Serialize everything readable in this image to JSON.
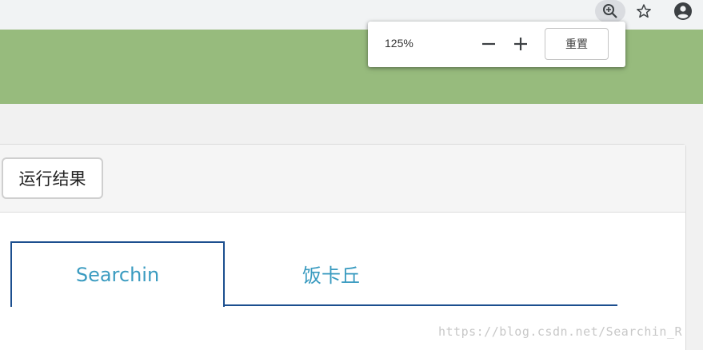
{
  "browser": {
    "icons": [
      "zoom-icon",
      "star-icon",
      "account-icon"
    ]
  },
  "zoom_popup": {
    "level": "125%",
    "reset_label": "重置"
  },
  "panel": {
    "run_button_label": "运行结果"
  },
  "tabs": [
    {
      "label": "Searchin",
      "active": true
    },
    {
      "label": "饭卡丘",
      "active": false
    }
  ],
  "watermark": "https://blog.csdn.net/Searchin_R",
  "colors": {
    "header_green": "#97bb7d",
    "tab_border": "#1c4f8f",
    "tab_text": "#3a9bc0"
  }
}
